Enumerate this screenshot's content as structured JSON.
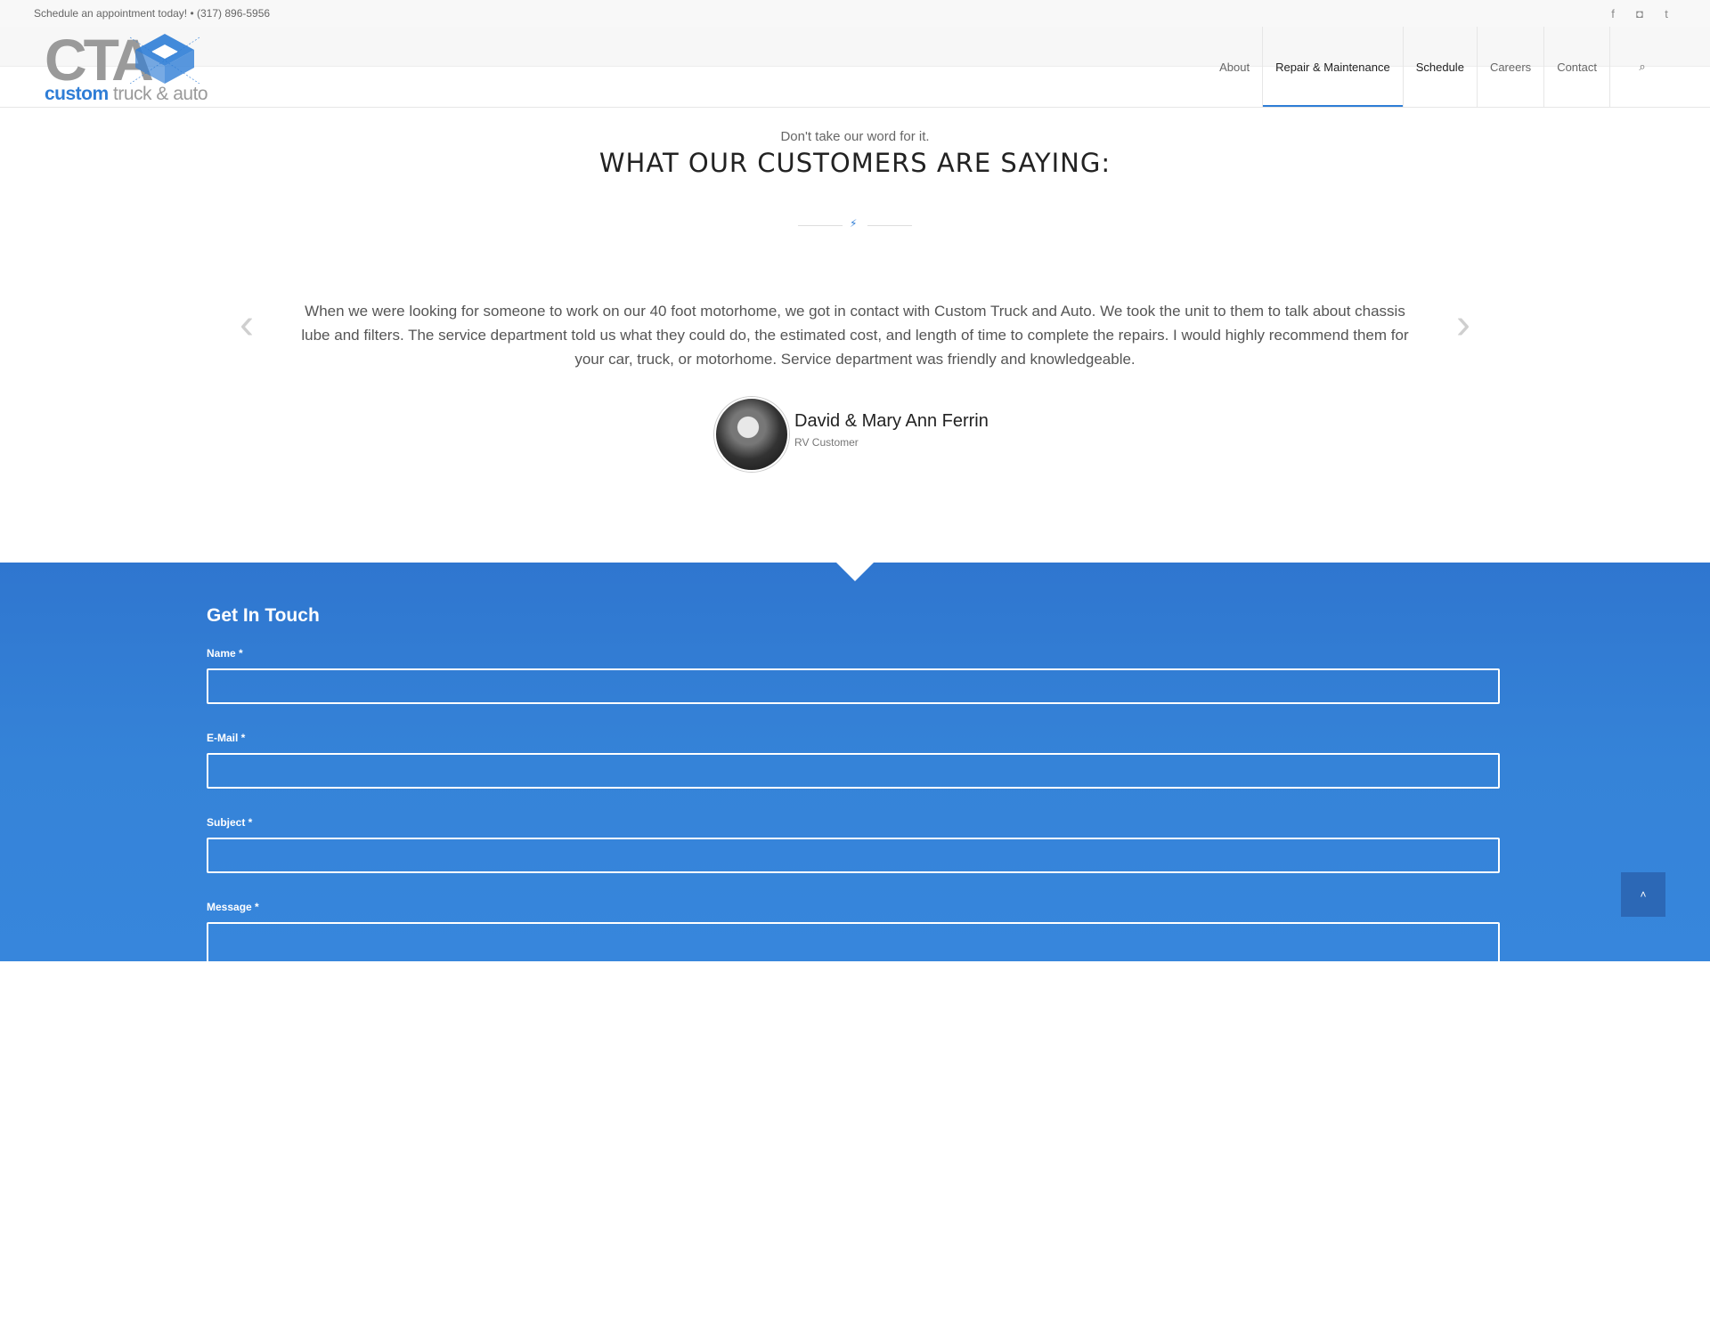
{
  "topbar": {
    "tagline": "Schedule an appointment today! • (317) 896-5956",
    "social": [
      {
        "icon": "facebook-icon",
        "glyph": "f"
      },
      {
        "icon": "instagram-icon",
        "glyph": "◘"
      },
      {
        "icon": "twitter-icon",
        "glyph": "t"
      }
    ]
  },
  "logo": {
    "big": "CTA",
    "sub_bold": "custom",
    "sub_rest": " truck & auto"
  },
  "nav": {
    "items": [
      "About",
      "Repair & Maintenance",
      "Schedule",
      "Careers",
      "Contact"
    ],
    "search_glyph": "⌕"
  },
  "testimonials": {
    "tagline": "Don't take our word for it.",
    "heading": "WHAT OUR CUSTOMERS ARE SAYING:",
    "quote": "When we were looking for someone to work on our 40 foot motorhome, we got in contact with Custom Truck and Auto. We took the unit to them to talk about chassis lube and filters. The service department told us what they could do, the estimated cost, and length of time to complete the repairs. I would highly recommend them for your car, truck, or motorhome. Service department was friendly and knowledgeable.",
    "author_name": "David & Mary Ann Ferrin",
    "author_role": "RV Customer",
    "prev_glyph": "‹",
    "next_glyph": "›"
  },
  "contact": {
    "title": "Get In Touch",
    "fields": {
      "name": "Name *",
      "email": "E-Mail *",
      "subject": "Subject *",
      "message": "Message *"
    }
  },
  "scroll_top_glyph": "˄",
  "colors": {
    "accent": "#2e7dd6",
    "contact_bg": "#3583d8"
  }
}
